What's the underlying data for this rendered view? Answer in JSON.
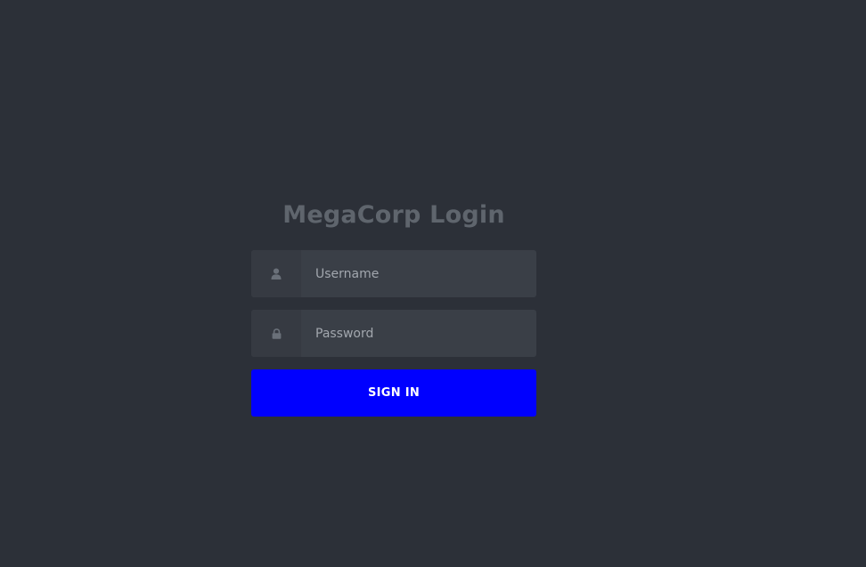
{
  "login": {
    "title": "MegaCorp Login",
    "username": {
      "placeholder": "Username",
      "value": "",
      "icon": "user-icon"
    },
    "password": {
      "placeholder": "Password",
      "value": "",
      "icon": "lock-icon"
    },
    "submit_label": "SIGN IN"
  },
  "colors": {
    "background": "#2c3038",
    "field_background": "#3a3f47",
    "icon_background": "#363a42",
    "title": "#5f656d",
    "button": "#0000ff",
    "button_text": "#ffffff"
  }
}
